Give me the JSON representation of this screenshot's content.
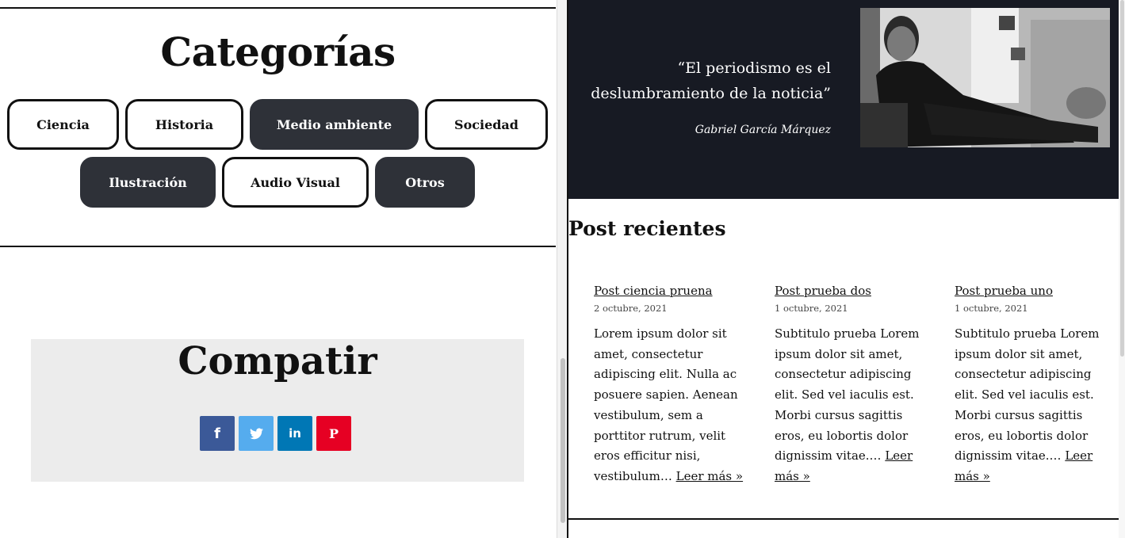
{
  "categories": {
    "title": "Categorías",
    "items": [
      {
        "label": "Ciencia"
      },
      {
        "label": "Historia"
      },
      {
        "label": "Medio ambiente"
      },
      {
        "label": "Sociedad"
      },
      {
        "label": "Ilustración"
      },
      {
        "label": "Audio Visual"
      },
      {
        "label": "Otros"
      }
    ]
  },
  "share": {
    "title": "Compatir",
    "buttons": [
      {
        "icon": "facebook-icon",
        "glyph": "f",
        "color": "#3b5998"
      },
      {
        "icon": "twitter-icon",
        "glyph": "🐦",
        "color": "#55acee"
      },
      {
        "icon": "linkedin-icon",
        "glyph": "in",
        "color": "#0077b5"
      },
      {
        "icon": "pinterest-icon",
        "glyph": "P",
        "color": "#e60023"
      }
    ]
  },
  "quote": {
    "text": "“El periodismo es el deslumbramiento de la noticia”",
    "author": "Gabriel García Márquez"
  },
  "recent": {
    "title": "Post recientes",
    "posts": [
      {
        "title": "Post ciencia pruena",
        "date": "2 octubre, 2021",
        "excerpt": "Lorem ipsum dolor sit amet, consectetur adipiscing elit. Nulla ac posuere sapien. Aenean vestibulum, sem a porttitor rutrum, velit eros efficitur nisi, vestibulum…",
        "read_more": "Leer más »"
      },
      {
        "title": "Post prueba dos",
        "date": "1 octubre, 2021",
        "excerpt": "Subtitulo prueba Lorem ipsum dolor sit amet, consectetur adipiscing elit. Sed vel iaculis est. Morbi cursus sagittis eros, eu lobortis dolor dignissim vitae.…",
        "read_more": "Leer más »"
      },
      {
        "title": "Post prueba uno",
        "date": "1 octubre, 2021",
        "excerpt": "Subtitulo prueba Lorem ipsum dolor sit amet, consectetur adipiscing elit. Sed vel iaculis est. Morbi cursus sagittis eros, eu lobortis dolor dignissim vitae.…",
        "read_more": "Leer más »"
      }
    ]
  },
  "colors": {
    "dark_pill": "#2e3138",
    "quote_band": "#171a23",
    "share_box": "#ececec"
  }
}
